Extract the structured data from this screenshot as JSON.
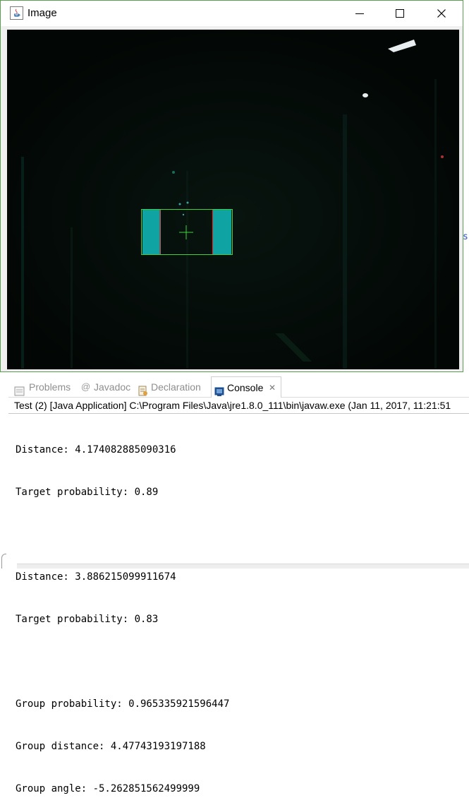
{
  "window": {
    "title": "Image",
    "minimize_icon": "minimize-icon",
    "maximize_icon": "maximize-icon",
    "close_icon": "close-icon"
  },
  "background_editor": {
    "partial_glyph": "s"
  },
  "tabs": [
    {
      "label": "Problems",
      "icon": "problems-icon",
      "active": false
    },
    {
      "label": "Javadoc",
      "icon": "at-icon",
      "active": false
    },
    {
      "label": "Declaration",
      "icon": "declaration-icon",
      "active": false
    },
    {
      "label": "Console",
      "icon": "console-icon",
      "active": true,
      "close": "✕"
    }
  ],
  "launch": "Test (2) [Java Application] C:\\Program Files\\Java\\jre1.8.0_111\\bin\\javaw.exe (Jan 11, 2017, 11:21:51",
  "console_lines": [
    "Distance: 4.174082885090316",
    "Target probability: 0.89",
    "",
    "Distance: 3.886215099911674",
    "Target probability: 0.83",
    "",
    "Group probability: 0.965335921596447",
    "Group distance: 4.47743193197188",
    "Group angle: -5.262851562499999"
  ],
  "colors": {
    "target_fill": "#0fa3a3",
    "bounding_box": "#3cd23c",
    "target_edge": "#d23232",
    "camera_bg": "#030805",
    "window_border": "#5aa050"
  }
}
